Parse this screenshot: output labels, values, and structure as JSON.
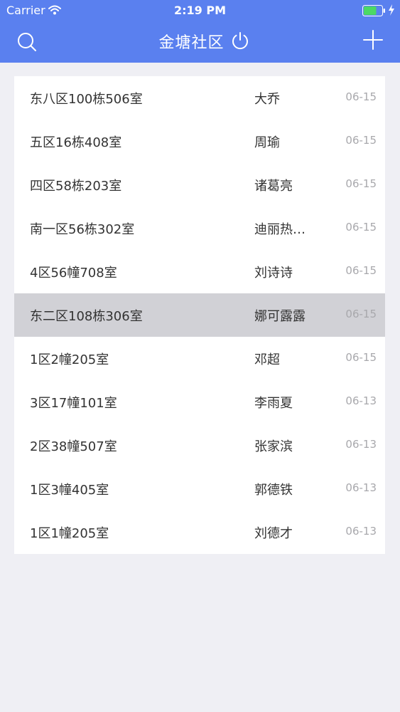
{
  "status_bar": {
    "carrier": "Carrier",
    "time": "2:19 PM",
    "battery_level": 0.7,
    "battery_color": "#4cd964"
  },
  "nav": {
    "title": "金塘社区",
    "left_icon": "search-icon",
    "title_icon": "power-icon",
    "right_icon": "plus-icon",
    "background": "#5a80ef"
  },
  "list": {
    "selected_index": 5,
    "rows": [
      {
        "address": "东八区100栋506室",
        "name": "大乔",
        "date": "06-15"
      },
      {
        "address": "五区16栋408室",
        "name": "周瑜",
        "date": "06-15"
      },
      {
        "address": "四区58栋203室",
        "name": "诸葛亮",
        "date": "06-15"
      },
      {
        "address": "南一区56栋302室",
        "name": "迪丽热…",
        "date": "06-15"
      },
      {
        "address": "4区56幢708室",
        "name": "刘诗诗",
        "date": "06-15"
      },
      {
        "address": "东二区108栋306室",
        "name": "娜可露露",
        "date": "06-15"
      },
      {
        "address": "1区2幢205室",
        "name": "邓超",
        "date": "06-15"
      },
      {
        "address": "3区17幢101室",
        "name": "李雨夏",
        "date": "06-13"
      },
      {
        "address": "2区38幢507室",
        "name": "张家滨",
        "date": "06-13"
      },
      {
        "address": "1区3幢405室",
        "name": "郭德铁",
        "date": "06-13"
      },
      {
        "address": "1区1幢205室",
        "name": "刘德才",
        "date": "06-13"
      }
    ]
  }
}
